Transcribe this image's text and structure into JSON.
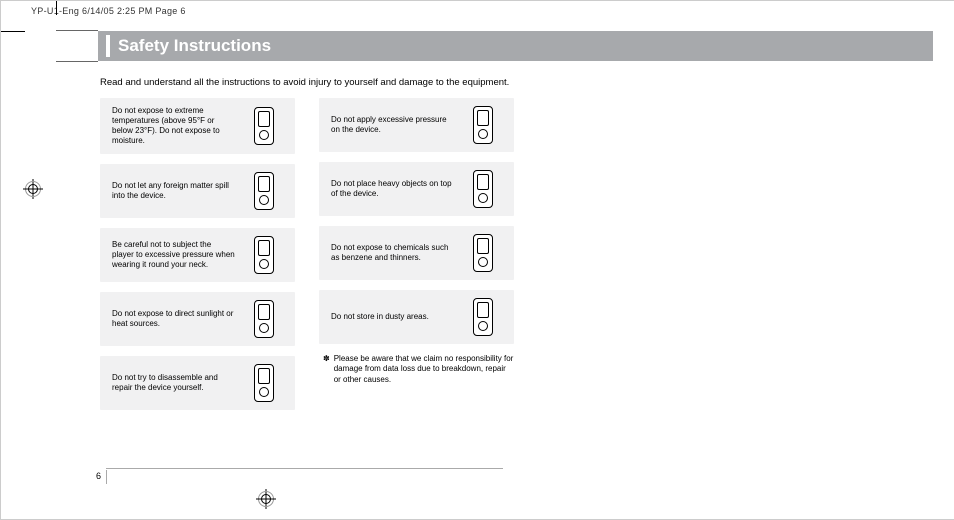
{
  "header_slug": "YP-U1-Eng  6/14/05 2:25 PM  Page 6",
  "title": "Safety Instructions",
  "intro": "Read and understand all the instructions to avoid injury to yourself and damage to the equipment.",
  "page_number": "6",
  "left_column": [
    "Do not expose to extreme temperatures (above 95°F or below 23°F). Do not expose to moisture.",
    "Do not let any foreign matter spill into the device.",
    "Be careful not to subject the player to excessive pressure when wearing it round your neck.",
    "Do not expose to direct sunlight or heat sources.",
    "Do not try to disassemble and repair the device yourself."
  ],
  "right_column": [
    "Do not apply excessive pressure on the device.",
    "Do not place heavy objects on top of the device.",
    "Do not expose to chemicals such as benzene and thinners.",
    "Do not store in dusty areas."
  ],
  "footnote_mark": "✽",
  "footnote": "Please be aware that we claim no responsibility for damage from data loss due to breakdown, repair or other causes."
}
